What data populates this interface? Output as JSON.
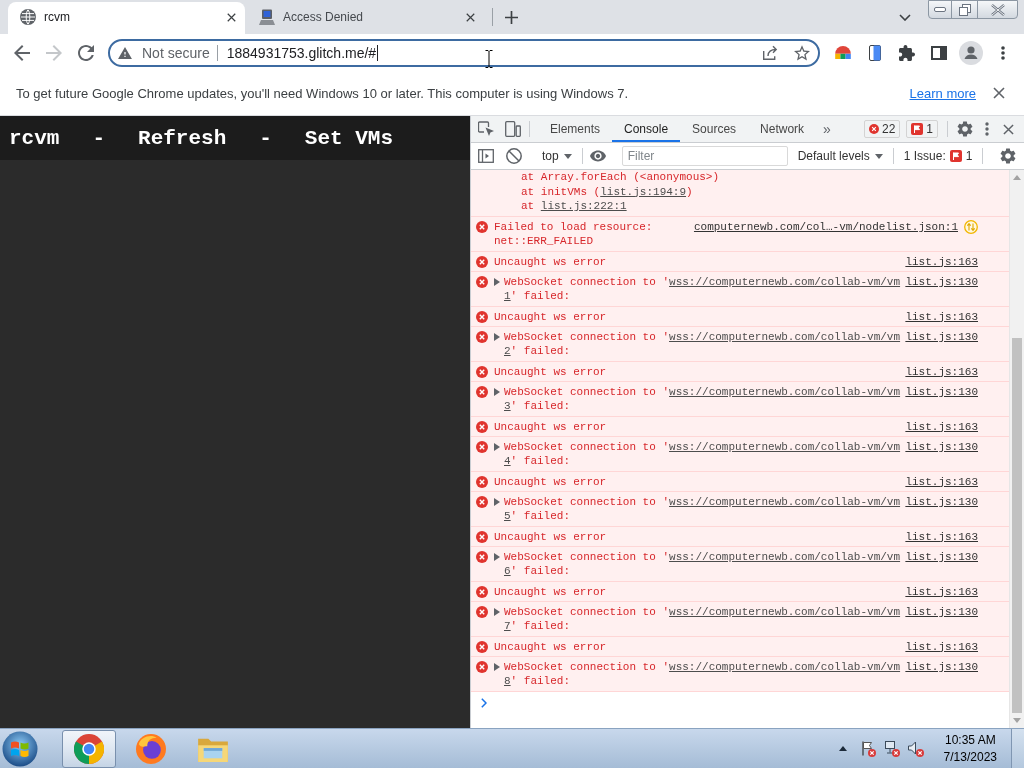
{
  "browser": {
    "tabs": [
      {
        "title": "rcvm",
        "selected": true
      },
      {
        "title": "Access Denied",
        "selected": false
      }
    ],
    "nav_buttons": [
      {
        "kind": "back",
        "disabled": false
      },
      {
        "kind": "forward",
        "disabled": true
      },
      {
        "kind": "reload",
        "disabled": false
      }
    ],
    "address_bar": {
      "security_label": "Not secure",
      "url": "1884931753.glitch.me/#"
    },
    "infobar": {
      "message": "To get future Google Chrome updates, you'll need Windows 10 or later. This computer is using Windows 7.",
      "link": "Learn more"
    }
  },
  "page": {
    "header": {
      "title": "rcvm",
      "links": [
        {
          "separator": "-",
          "label": "Refresh"
        },
        {
          "separator": "-",
          "label": "Set VMs"
        }
      ]
    }
  },
  "devtools": {
    "tabs": [
      {
        "label": "Elements",
        "selected": false
      },
      {
        "label": "Console",
        "selected": true
      },
      {
        "label": "Sources",
        "selected": false
      },
      {
        "label": "Network",
        "selected": false
      }
    ],
    "more_tabs": "»",
    "error_count": "22",
    "issue_count": "1",
    "console_toolbar": {
      "context": "top",
      "filter": {
        "placeholder": "Filter"
      },
      "levels": "Default levels",
      "issues_label": "1 Issue:",
      "issues_count": "1"
    },
    "messages": [
      {
        "kind": "trace",
        "lines": [
          {
            "text": "at Array.forEach (<anonymous>)"
          },
          {
            "text": "at initVMs (",
            "link": "list.js:194:9",
            "after": ")"
          },
          {
            "text": "at ",
            "link": "list.js:222:1"
          }
        ]
      },
      {
        "kind": "network-error",
        "text": "Failed to load resource: net::ERR_FAILED",
        "source": "computernewb.com/col…-vm/nodelist.json:1"
      },
      {
        "kind": "error",
        "text": "Uncaught ws error",
        "source": "list.js:163"
      },
      {
        "kind": "websocket-error",
        "expanded": false,
        "text": "WebSocket connection to '",
        "link": "wss://computernewb.com/collab-vm/vm1",
        "after": "' failed:",
        "source": "list.js:130"
      },
      {
        "kind": "error",
        "text": "Uncaught ws error",
        "source": "list.js:163"
      },
      {
        "kind": "websocket-error",
        "expanded": false,
        "text": "WebSocket connection to '",
        "link": "wss://computernewb.com/collab-vm/vm2",
        "after": "' failed:",
        "source": "list.js:130"
      },
      {
        "kind": "error",
        "text": "Uncaught ws error",
        "source": "list.js:163"
      },
      {
        "kind": "websocket-error",
        "expanded": false,
        "text": "WebSocket connection to '",
        "link": "wss://computernewb.com/collab-vm/vm3",
        "after": "' failed:",
        "source": "list.js:130"
      },
      {
        "kind": "error",
        "text": "Uncaught ws error",
        "source": "list.js:163"
      },
      {
        "kind": "websocket-error",
        "expanded": false,
        "text": "WebSocket connection to '",
        "link": "wss://computernewb.com/collab-vm/vm4",
        "after": "' failed:",
        "source": "list.js:130"
      },
      {
        "kind": "error",
        "text": "Uncaught ws error",
        "source": "list.js:163"
      },
      {
        "kind": "websocket-error",
        "expanded": false,
        "text": "WebSocket connection to '",
        "link": "wss://computernewb.com/collab-vm/vm5",
        "after": "' failed:",
        "source": "list.js:130"
      },
      {
        "kind": "error",
        "text": "Uncaught ws error",
        "source": "list.js:163"
      },
      {
        "kind": "websocket-error",
        "expanded": false,
        "text": "WebSocket connection to '",
        "link": "wss://computernewb.com/collab-vm/vm6",
        "after": "' failed:",
        "source": "list.js:130"
      },
      {
        "kind": "error",
        "text": "Uncaught ws error",
        "source": "list.js:163"
      },
      {
        "kind": "websocket-error",
        "expanded": false,
        "text": "WebSocket connection to '",
        "link": "wss://computernewb.com/collab-vm/vm7",
        "after": "' failed:",
        "source": "list.js:130"
      },
      {
        "kind": "error",
        "text": "Uncaught ws error",
        "source": "list.js:163"
      },
      {
        "kind": "websocket-error",
        "expanded": false,
        "text": "WebSocket connection to '",
        "link": "wss://computernewb.com/collab-vm/vm8",
        "after": "' failed:",
        "source": "list.js:130"
      }
    ]
  },
  "taskbar": {
    "apps": [
      {
        "kind": "chrome",
        "active": true
      },
      {
        "kind": "firefox",
        "active": false
      },
      {
        "kind": "explorer",
        "active": false
      }
    ],
    "clock": {
      "time": "10:35 AM",
      "date": "7/13/2023"
    }
  }
}
